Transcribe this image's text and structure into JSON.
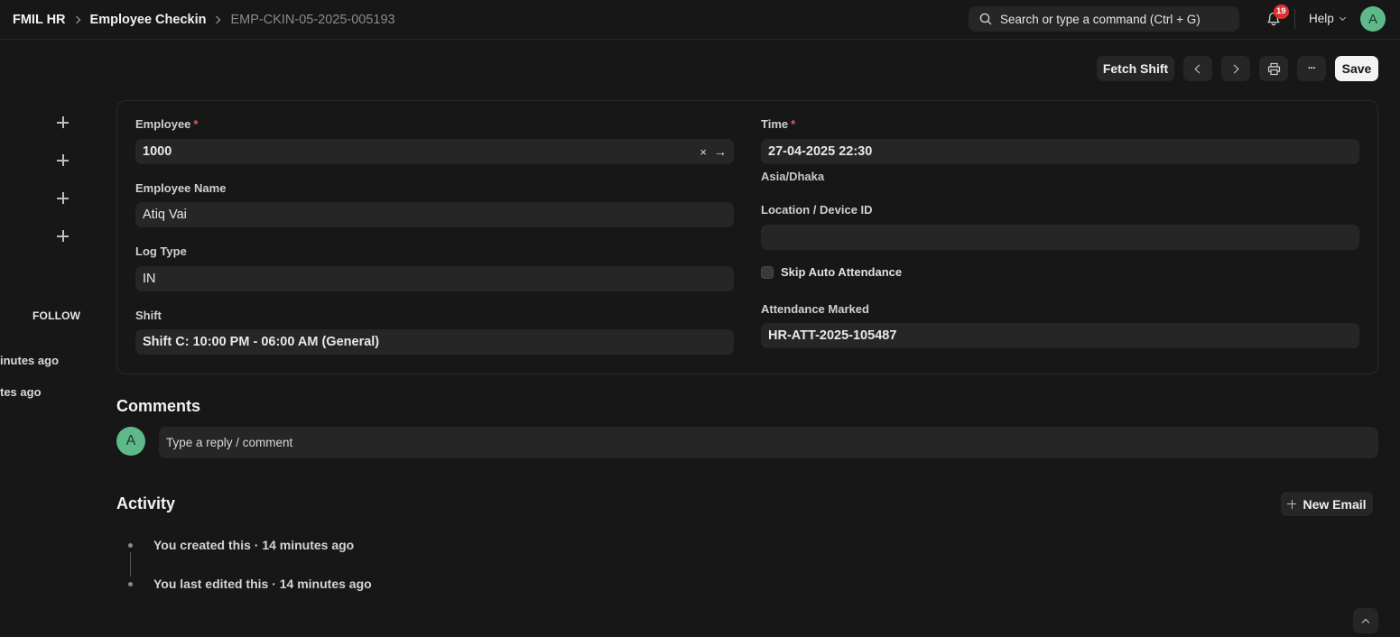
{
  "breadcrumbs": [
    "FMIL HR",
    "Employee Checkin",
    "EMP-CKIN-05-2025-005193"
  ],
  "navbar": {
    "search_placeholder": "Search or type a command (Ctrl + G)",
    "notification_count": "19",
    "help_label": "Help",
    "user_initial": "A",
    "avatar_color": "#5fb88a"
  },
  "toolbar": {
    "fetch_shift_label": "Fetch Shift",
    "more_label": "···",
    "save_label": "Save"
  },
  "sidebar": {
    "follow_label": "FOLLOW",
    "times": [
      "inutes ago",
      "tes ago"
    ]
  },
  "form": {
    "employee": {
      "label": "Employee",
      "required_mark": "*",
      "value": "1000",
      "clear_icon": "×",
      "link_icon": "→"
    },
    "employee_name": {
      "label": "Employee Name",
      "value": "Atiq Vai"
    },
    "log_type": {
      "label": "Log Type",
      "value": "IN"
    },
    "shift": {
      "label": "Shift",
      "value": "Shift C: 10:00 PM - 06:00 AM (General)"
    },
    "time": {
      "label": "Time",
      "required_mark": "*",
      "value": "27-04-2025 22:30",
      "timezone": "Asia/Dhaka"
    },
    "location": {
      "label": "Location / Device ID",
      "value": ""
    },
    "skip_auto_attendance": {
      "label": "Skip Auto Attendance",
      "checked": false
    },
    "attendance_marked": {
      "label": "Attendance Marked",
      "value": "HR-ATT-2025-105487"
    }
  },
  "comments": {
    "title": "Comments",
    "avatar_initial": "A",
    "placeholder": "Type a reply / comment"
  },
  "activity": {
    "title": "Activity",
    "new_email_label": "New Email",
    "items": [
      "You created this · 14 minutes ago",
      "You last edited this · 14 minutes ago"
    ]
  },
  "colors": {
    "background": "#171717",
    "surface": "#262626",
    "required": "#e05a5a",
    "badge": "#e03131"
  }
}
